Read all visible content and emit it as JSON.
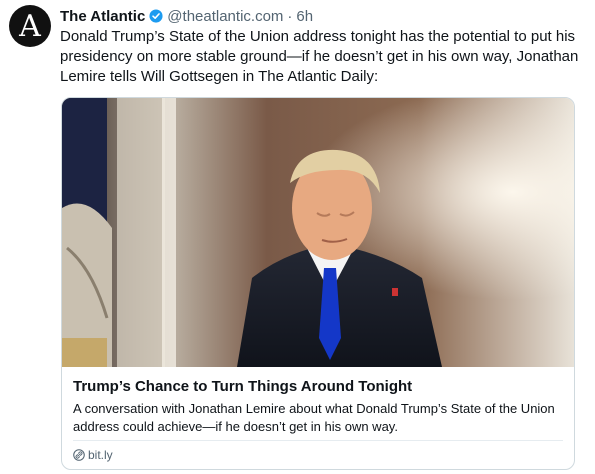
{
  "author": {
    "avatar_letter": "A",
    "display_name": "The Atlantic",
    "handle": "@theatlantic.com",
    "separator": "·",
    "timestamp": "6h",
    "verified_icon": "verified-check-icon",
    "verified_color": "#1d9bf0"
  },
  "post": {
    "text": "Donald Trump’s State of the Union address tonight has the potential to put his presidency on more stable ground—if he doesn’t get in his own way, Jonathan Lemire tells Will Gottsegen in The Atlantic Daily:"
  },
  "link_card": {
    "image_icon": "photo",
    "title": "Trump’s Chance to Turn Things Around Tonight",
    "description": "A conversation with Jonathan Lemire about what Donald Trump’s State of the Union address could achieve—if he doesn’t get in his own way.",
    "domain": "bit.ly",
    "domain_icon": "link-icon"
  },
  "colors": {
    "text": "#0f1419",
    "secondary_text": "#536471",
    "border": "#cfd9de",
    "accent": "#1d9bf0"
  }
}
